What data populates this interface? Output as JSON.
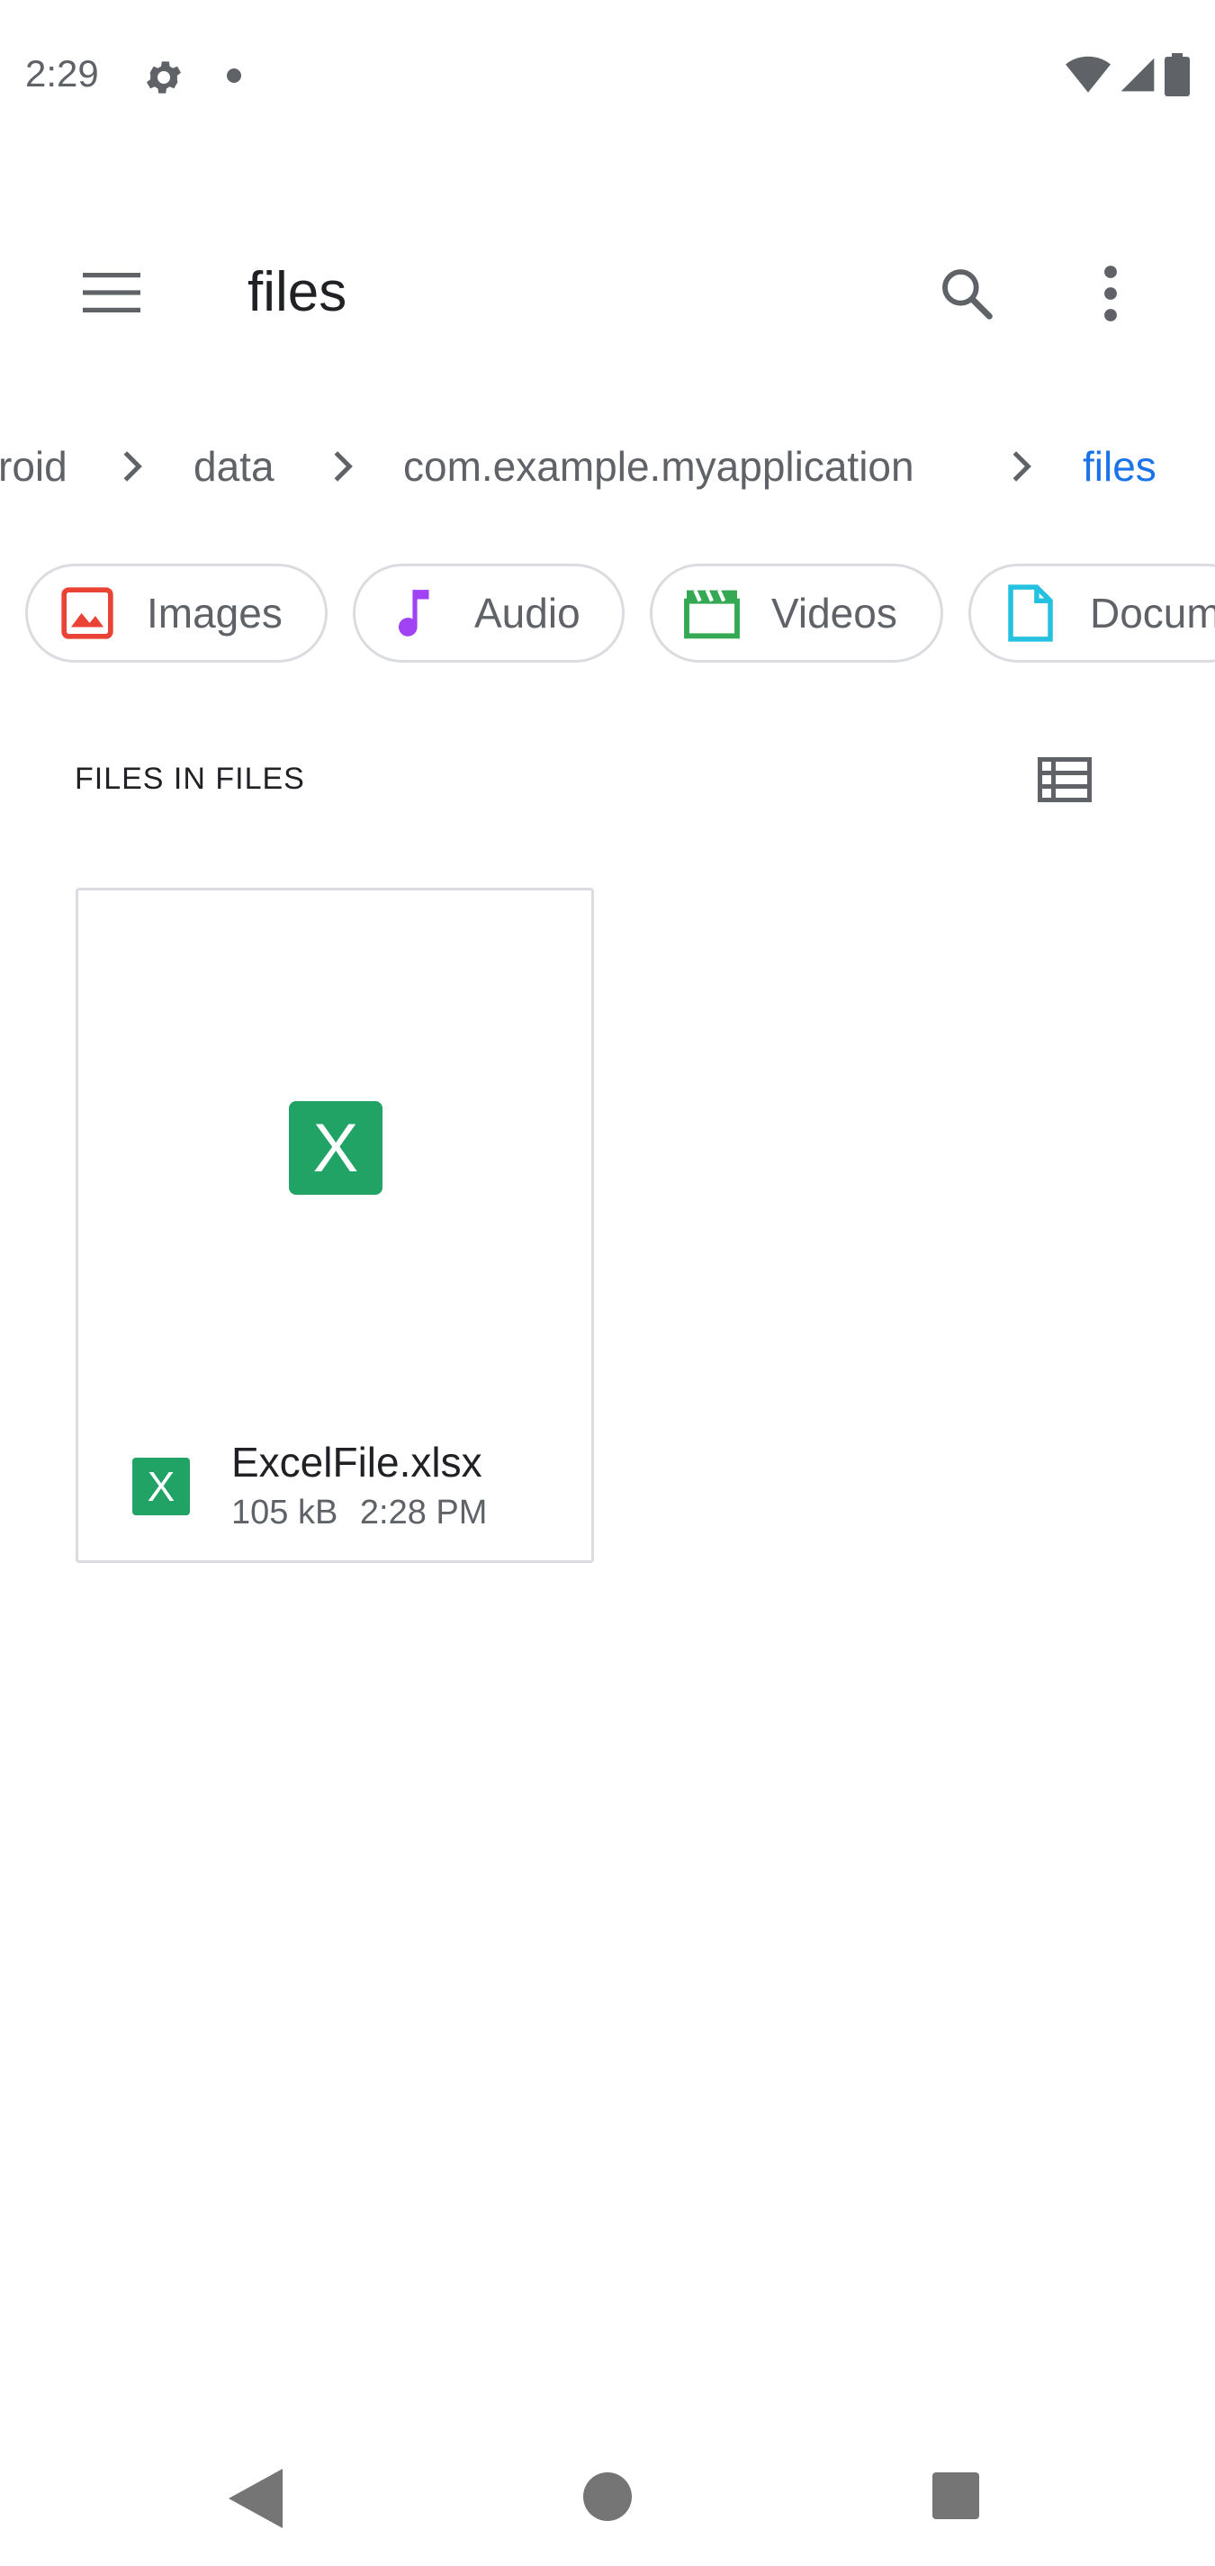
{
  "status_bar": {
    "time": "2:29",
    "icons": [
      "gear-icon",
      "notification-dot-icon",
      "wifi-icon",
      "cell-signal-icon",
      "battery-icon"
    ]
  },
  "app_bar": {
    "title": "files",
    "icons": [
      "menu-icon",
      "search-icon",
      "more-vert-icon"
    ]
  },
  "breadcrumb": {
    "items": [
      {
        "label": "roid"
      },
      {
        "label": "data"
      },
      {
        "label": "com.example.myapplication"
      },
      {
        "label": "files",
        "active": true
      }
    ]
  },
  "chips": [
    {
      "label": "Images",
      "icon": "image-icon",
      "color": "#ea4335"
    },
    {
      "label": "Audio",
      "icon": "music-note-icon",
      "color": "#a142f4"
    },
    {
      "label": "Videos",
      "icon": "clapperboard-icon",
      "color": "#34a853"
    },
    {
      "label": "Docum",
      "icon": "document-icon",
      "color": "#24c1e0"
    }
  ],
  "section": {
    "title": "FILES IN FILES",
    "view_toggle_icon": "list-view-icon"
  },
  "files": [
    {
      "name": "ExcelFile.xlsx",
      "size": "105 kB",
      "modified": "2:28 PM",
      "icon_letter": "X",
      "icon_color": "#21a366"
    }
  ],
  "nav_bar": {
    "icons": [
      "back-icon",
      "home-icon",
      "recents-icon"
    ]
  },
  "colors": {
    "accent": "#1a73e8",
    "text_secondary": "#5f6368",
    "outline": "#dadce0",
    "excel_green": "#21a366"
  }
}
